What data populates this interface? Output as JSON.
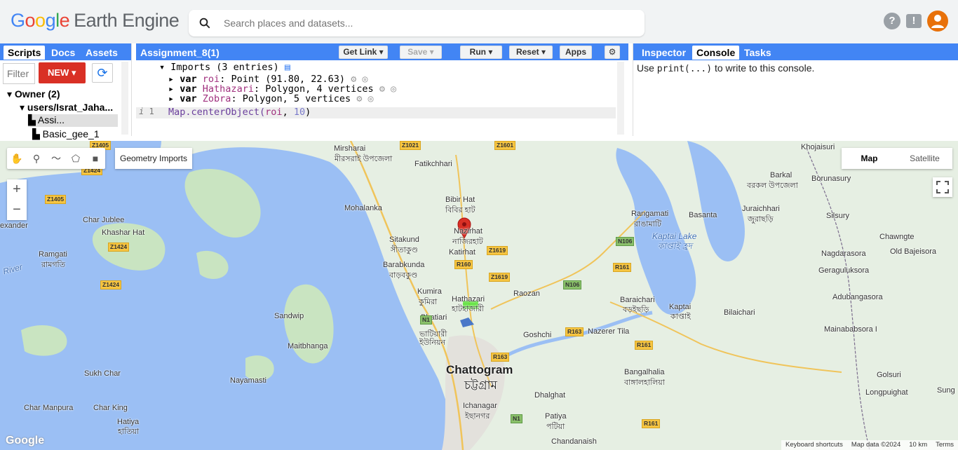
{
  "brand": {
    "google": "Google",
    "product": "Earth Engine"
  },
  "search": {
    "placeholder": "Search places and datasets..."
  },
  "top_icons": [
    "help-icon",
    "feedback-icon",
    "account-avatar"
  ],
  "left_panel": {
    "tabs": [
      "Scripts",
      "Docs",
      "Assets"
    ],
    "filter_placeholder": "Filter",
    "new_label": "NEW",
    "tree": {
      "owner": "Owner (2)",
      "user": "users/Israt_Jaha...",
      "items": [
        "Assi...",
        "Basic_gee_1"
      ]
    }
  },
  "editor": {
    "title": "Assignment_8(1)",
    "buttons": {
      "get_link": "Get Link",
      "save": "Save",
      "run": "Run",
      "reset": "Reset",
      "apps": "Apps"
    },
    "imports_header": "Imports (3 entries)",
    "imports": [
      {
        "kw": "var",
        "name": "roi",
        "desc": ": Point (91.80, 22.63)"
      },
      {
        "kw": "var",
        "name": "Hathazari",
        "desc": ": Polygon, 4 vertices"
      },
      {
        "kw": "var",
        "name": "Zobra",
        "desc": ": Polygon, 5 vertices"
      }
    ],
    "line_number": "1",
    "code": {
      "fn": "Map.centerObject(",
      "arg": "roi",
      "sep": ", ",
      "num": "10",
      "close": ")"
    }
  },
  "right_panel": {
    "tabs": [
      "Inspector",
      "Console",
      "Tasks"
    ],
    "console": {
      "pre": "Use ",
      "code": "print(...)",
      "post": " to write to this console."
    }
  },
  "map": {
    "tools_label": "Geometry Imports",
    "maptype": [
      "Map",
      "Satellite"
    ],
    "zoom": [
      "+",
      "−"
    ],
    "places": [
      "Mirsharai",
      "মীরসরাই উপজেলা",
      "Fatikchhari",
      "Bibir Hat",
      "বিবির হাট",
      "Nazirhat",
      "নাজিরহাট",
      "Katirhat",
      "Mohalanka",
      "Sitakund",
      "সীতাকুণ্ড",
      "Barabkunda",
      "বাড়বকুণ্ড",
      "Kumira",
      "কুমিরা",
      "Hathazari",
      "হাটহাজারী",
      "Bhatiari",
      "ভাটিয়ারী ইউনিয়ন",
      "Chattogram",
      "চট্টগ্রাম",
      "Ichanagar",
      "ইছানগর",
      "Dhalghat",
      "Patiya",
      "পটিয়া",
      "Chandanaish",
      "Goshchi",
      "Raozan",
      "Nazerer Tila",
      "Baraichari",
      "বড়ইছড়ি",
      "Kaptai",
      "কাপ্তাই",
      "Rangamati",
      "রাঙামাটি",
      "Basanta",
      "Kaptai Lake",
      "কাপ্তাই হ্রদ",
      "Juraichhari",
      "জুরাছড়ি",
      "Barkal",
      "বরকল উপজেলা",
      "Khojaisuri",
      "Borunasury",
      "Silsury",
      "Chawngte",
      "Nagdarasora",
      "Old Bajeisora",
      "Geraguluksora",
      "Adubangasora",
      "Bilaichari",
      "Mainababsora I",
      "Golsuri",
      "Longpuighat",
      "Sung",
      "Bangalhalia",
      "বাঙ্গালহালিয়া",
      "Sandwip",
      "Maitbhanga",
      "Nayamasti",
      "Sukh Char",
      "Char Manpura",
      "Char King",
      "Hatiya",
      "হাতিয়া",
      "Char Jublee",
      "Khashar Hat",
      "Ramgati",
      "রামগতি",
      "River",
      "exander"
    ],
    "shields": [
      "Z1405",
      "Z1424",
      "Z1405",
      "Z1424",
      "Z1424",
      "Z1021",
      "Z1601",
      "Z1619",
      "Z1619",
      "R160",
      "N106",
      "N106",
      "R161",
      "R163",
      "R161",
      "R163",
      "N1",
      "N1",
      "R161"
    ],
    "attribution": [
      "Keyboard shortcuts",
      "Map data ©2024",
      "10 km",
      "Terms"
    ]
  }
}
